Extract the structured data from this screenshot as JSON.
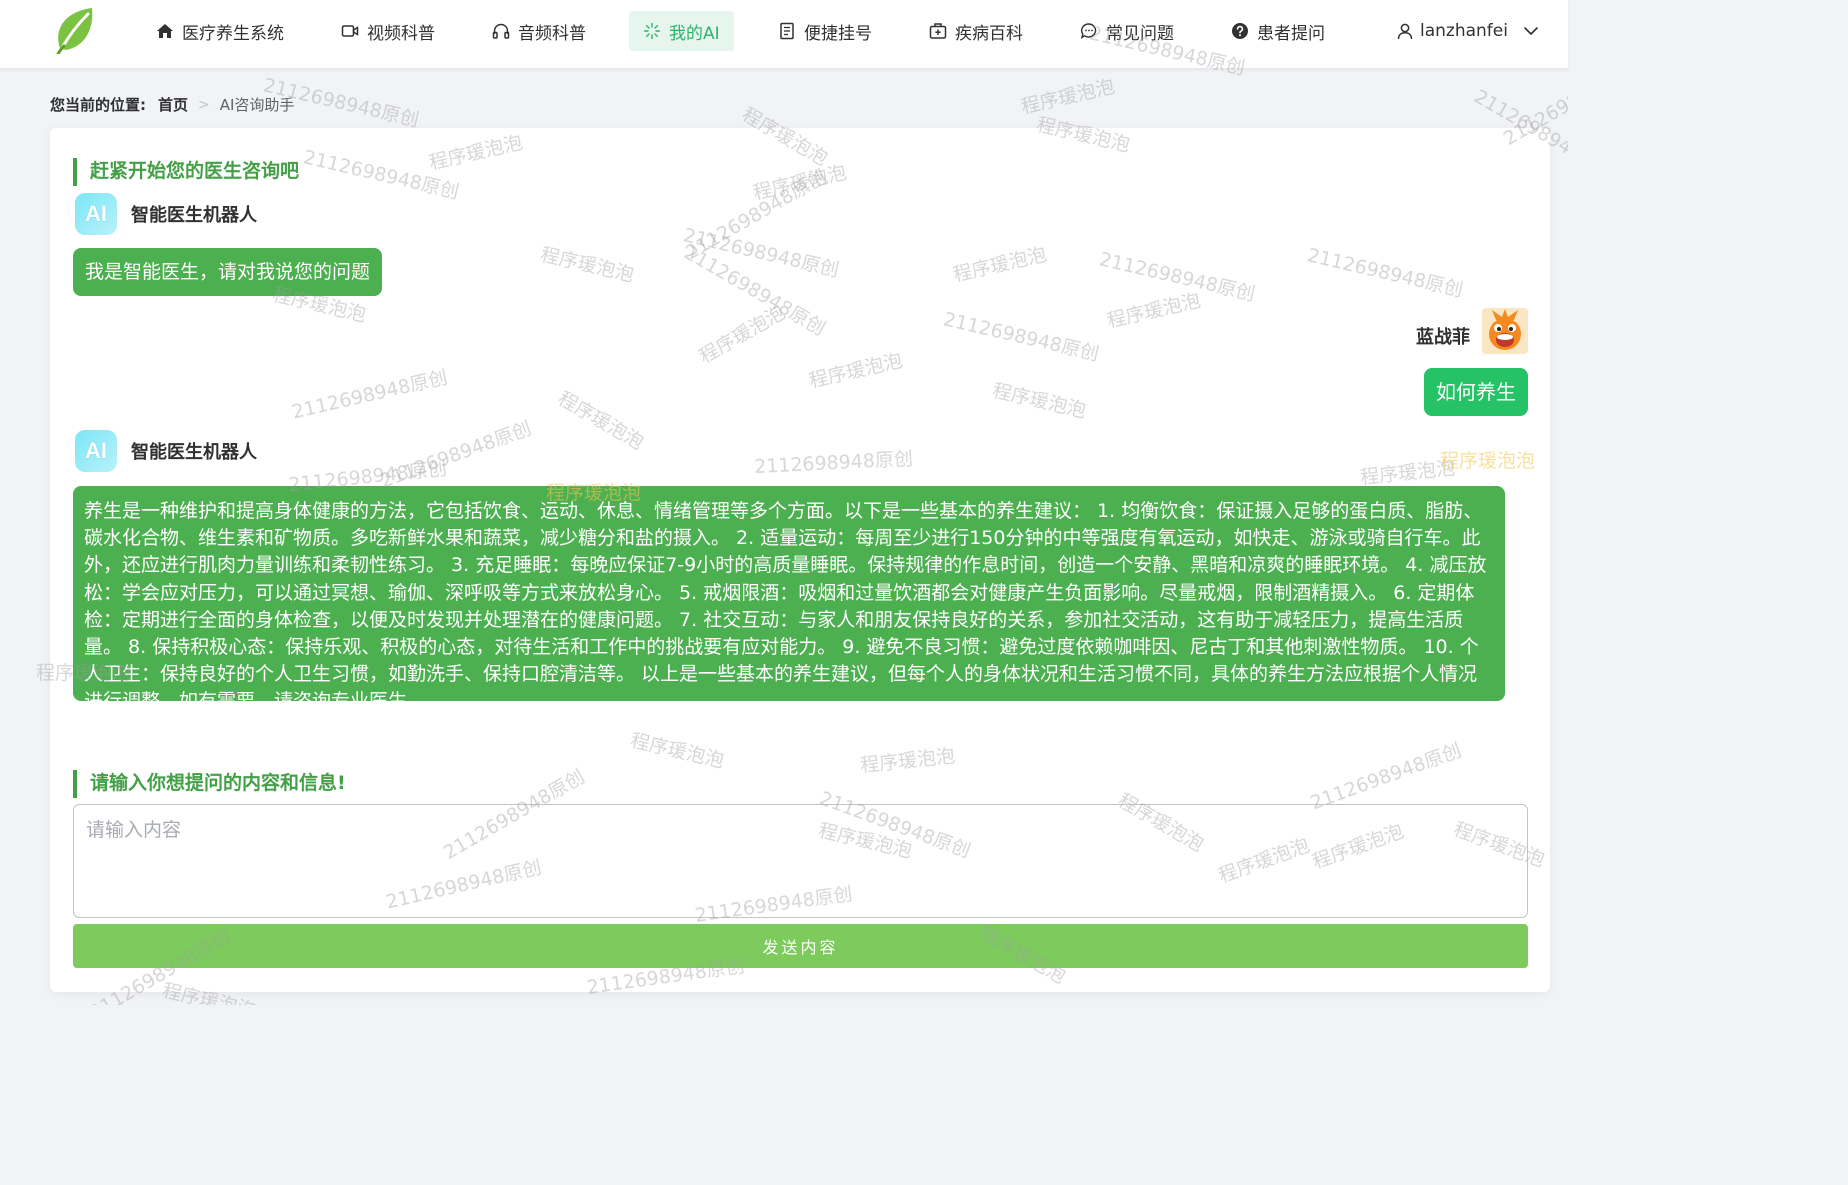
{
  "nav": {
    "items": [
      {
        "label": "医疗养生系统",
        "icon": "home-icon"
      },
      {
        "label": "视频科普",
        "icon": "video-icon"
      },
      {
        "label": "音频科普",
        "icon": "headphones-icon"
      },
      {
        "label": "我的AI",
        "icon": "sparkle-icon",
        "active": true
      },
      {
        "label": "便捷挂号",
        "icon": "document-icon"
      },
      {
        "label": "疾病百科",
        "icon": "medical-kit-icon"
      },
      {
        "label": "常见问题",
        "icon": "chat-icon"
      },
      {
        "label": "患者提问",
        "icon": "question-icon"
      }
    ],
    "username": "lanzhanfei"
  },
  "breadcrumb": {
    "lead": "您当前的位置:",
    "home": "首页",
    "current": "AI咨询助手"
  },
  "chat": {
    "section_title": "赶紧开始您的医生咨询吧",
    "bot_icon_text": "AI",
    "bot_name": "智能医生机器人",
    "greeting": "我是智能医生，请对我说您的问题",
    "user_name": "蓝战菲",
    "user_question": "如何养生",
    "answer": "养生是一种维护和提高身体健康的方法，它包括饮食、运动、休息、情绪管理等多个方面。以下是一些基本的养生建议： 1. 均衡饮食：保证摄入足够的蛋白质、脂肪、碳水化合物、维生素和矿物质。多吃新鲜水果和蔬菜，减少糖分和盐的摄入。 2. 适量运动：每周至少进行150分钟的中等强度有氧运动，如快走、游泳或骑自行车。此外，还应进行肌肉力量训练和柔韧性练习。 3. 充足睡眠：每晚应保证7-9小时的高质量睡眠。保持规律的作息时间，创造一个安静、黑暗和凉爽的睡眠环境。 4. 减压放松：学会应对压力，可以通过冥想、瑜伽、深呼吸等方式来放松身心。 5. 戒烟限酒：吸烟和过量饮酒都会对健康产生负面影响。尽量戒烟，限制酒精摄入。 6. 定期体检：定期进行全面的身体检查，以便及时发现并处理潜在的健康问题。 7. 社交互动：与家人和朋友保持良好的关系，参加社交活动，这有助于减轻压力，提高生活质量。 8. 保持积极心态：保持乐观、积极的心态，对待生活和工作中的挑战要有应对能力。 9. 避免不良习惯：避免过度依赖咖啡因、尼古丁和其他刺激性物质。 10. 个人卫生：保持良好的个人卫生习惯，如勤洗手、保持口腔清洁等。 以上是一些基本的养生建议，但每个人的身体状况和生活习惯不同，具体的养生方法应根据个人情况进行调整。如有需要，请咨询专业医生。"
  },
  "input": {
    "section_title": "请输入你想提问的内容和信息!",
    "placeholder": "请输入内容",
    "value": "",
    "send_label": "发送内容"
  },
  "watermarks": [
    "2112698948原创",
    "程序瑗泡泡"
  ],
  "colors": {
    "brand_green": "#43a047",
    "bubble_green": "#4caf50",
    "user_bubble_green": "#26c266",
    "send_button": "#7ccb5c",
    "nav_active_bg": "#e6f6ee"
  }
}
